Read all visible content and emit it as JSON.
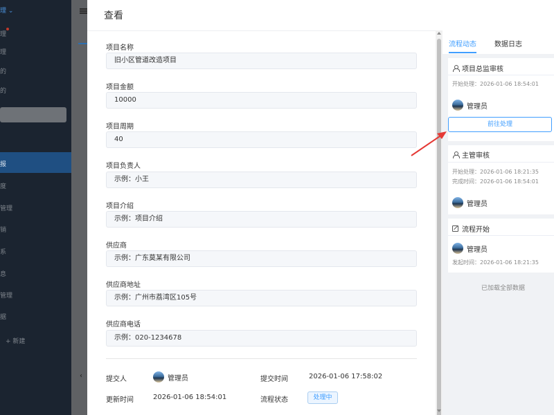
{
  "background_sidebar": {
    "items": [
      "理",
      "理",
      "的",
      "的",
      "报",
      "度",
      "管理",
      "销",
      "系",
      "息",
      "管理",
      "据",
      "+ 新建"
    ]
  },
  "drawer": {
    "title": "查看",
    "fields": [
      {
        "label": "项目名称",
        "value": "旧小区管道改造项目"
      },
      {
        "label": "项目金额",
        "value": "10000"
      },
      {
        "label": "项目周期",
        "value": "40"
      },
      {
        "label": "项目负责人",
        "value": "示例：小王"
      },
      {
        "label": "项目介绍",
        "value": "示例：项目介绍"
      },
      {
        "label": "供应商",
        "value": "示例：广东莫某有限公司"
      },
      {
        "label": "供应商地址",
        "value": "示例：广州市荔湾区105号"
      },
      {
        "label": "供应商电话",
        "value": "示例：020-1234678"
      }
    ],
    "meta": {
      "submitter_label": "提交人",
      "submitter": "管理员",
      "submit_time_label": "提交时间",
      "submit_time": "2026-01-06 17:58:02",
      "update_time_label": "更新时间",
      "update_time": "2026-01-06 18:54:01",
      "status_label": "流程状态",
      "status": "处理中"
    }
  },
  "right_panel": {
    "tabs": [
      "流程动态",
      "数据日志"
    ],
    "active_tab": "流程动态",
    "steps": [
      {
        "title": "项目总监审核",
        "times": [
          "开始处理：2026-01-06 18:54:01"
        ],
        "user": "管理员",
        "button": "前往处理"
      },
      {
        "title": "主管审核",
        "times": [
          "开始处理：2026-01-06 18:21:35",
          "完成时间：2026-01-06 18:54:01"
        ],
        "user": "管理员"
      },
      {
        "title": "流程开始",
        "user": "管理员",
        "times": [
          "发起时间：2026-01-06 18:21:35"
        ]
      }
    ],
    "footer": "已加载全部数据"
  },
  "colors": {
    "primary": "#409eff",
    "sidebar_bg": "#1b2430",
    "overlay_bg": "#5b5d60",
    "arrow": "#e53935"
  }
}
